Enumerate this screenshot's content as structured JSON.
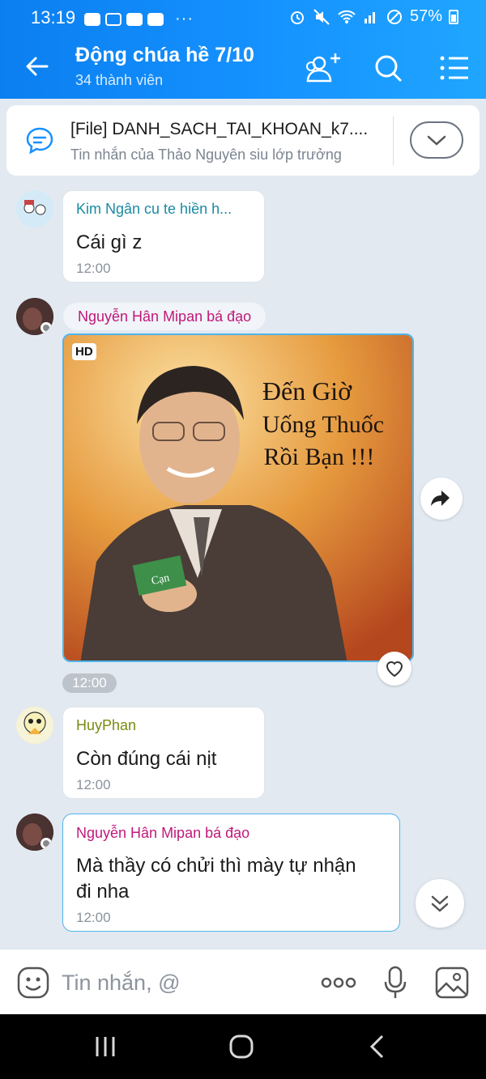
{
  "status_bar": {
    "time": "13:19",
    "battery": "57%",
    "dots": "···"
  },
  "header": {
    "title": "Động chúa hề 7/10",
    "subtitle": "34 thành viên"
  },
  "pinned": {
    "title": "[File] DANH_SACH_TAI_KHOAN_k7....",
    "subtitle": "Tin nhắn của Thảo Nguyên siu lớp trưởng"
  },
  "messages": [
    {
      "sender": "Kim Ngân cu te hiền h...",
      "sender_color": "#1a8aa3",
      "text": "Cái gì z",
      "time": "12:00"
    },
    {
      "sender": "Nguyễn Hân Mipan bá đạo",
      "sender_color": "#c0197a",
      "type": "image",
      "badge": "HD",
      "image_caption": "Đến Giờ Uống Thuốc Rồi Bạn !!!",
      "time": "12:00"
    },
    {
      "sender": "HuyPhan",
      "sender_color": "#7a8a10",
      "text": "Còn đúng cái nịt",
      "time": "12:00"
    },
    {
      "sender": "Nguyễn Hân Mipan bá đạo",
      "sender_color": "#c0197a",
      "text_line1": "Mà thầy có chửi thì mày tự nhận",
      "text_line2": "đi nha",
      "time": "12:00"
    }
  ],
  "photo": {
    "caption_line1": "Đến Giờ",
    "caption_line2": "Uống Thuốc",
    "caption_line3": "Rồi Bạn !!!",
    "card_text": "Cạn"
  },
  "input": {
    "placeholder": "Tin nhắn, @"
  },
  "colors": {
    "header_gradient_start": "#0b7ff0",
    "header_gradient_end": "#20a6ff",
    "chat_background": "#e2e9f1",
    "highlight_border": "#4fb4ea"
  }
}
